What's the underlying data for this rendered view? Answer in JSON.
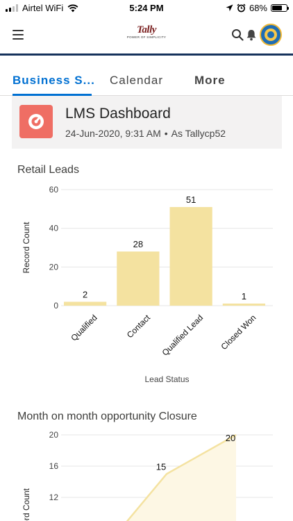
{
  "status_bar": {
    "carrier": "Airtel WiFi",
    "time": "5:24 PM",
    "battery": "68%",
    "battery_level": 0.68
  },
  "header": {
    "brand": "Tally",
    "brand_tagline": "POWER OF SIMPLICITY"
  },
  "tabs": [
    {
      "label": "Business S...",
      "active": true
    },
    {
      "label": "Calendar",
      "active": false
    },
    {
      "label": "More",
      "active": false
    }
  ],
  "dashboard": {
    "title": "LMS Dashboard",
    "date": "24-Jun-2020, 9:31 AM",
    "separator": "•",
    "owner": "As Tallycp52"
  },
  "charts": {
    "retail_leads_title": "Retail Leads",
    "month_closure_title": "Month on month opportunity Closure"
  },
  "chart_data": [
    {
      "type": "bar",
      "title": "Retail Leads",
      "xlabel": "Lead Status",
      "ylabel": "Record Count",
      "categories": [
        "Qualified",
        "Contact",
        "Qualified Lead",
        "Closed Won"
      ],
      "values": [
        2,
        28,
        51,
        1
      ],
      "ylim": [
        0,
        60
      ],
      "yticks": [
        0,
        20,
        40,
        60
      ],
      "bar_color": "#f4e2a0",
      "grid": true
    },
    {
      "type": "line",
      "title": "Month on month opportunity Closure",
      "ylabel": "Record Count",
      "visible_points": [
        {
          "label": "15",
          "value": 15
        },
        {
          "label": "20",
          "value": 20
        }
      ],
      "yticks": [
        12,
        16,
        20
      ],
      "ylim": [
        10,
        20
      ],
      "line_color": "#f4e2a0",
      "grid": true
    }
  ],
  "colors": {
    "accent": "#0070d2",
    "header_rule": "#16325c",
    "dashboard_icon": "#ef6e64",
    "card_background": "#f3f2f2"
  },
  "icons": {
    "menu": "hamburger-icon",
    "search": "search-icon",
    "notifications": "bell-icon",
    "profile": "avatar",
    "dashboard": "gauge-icon"
  }
}
